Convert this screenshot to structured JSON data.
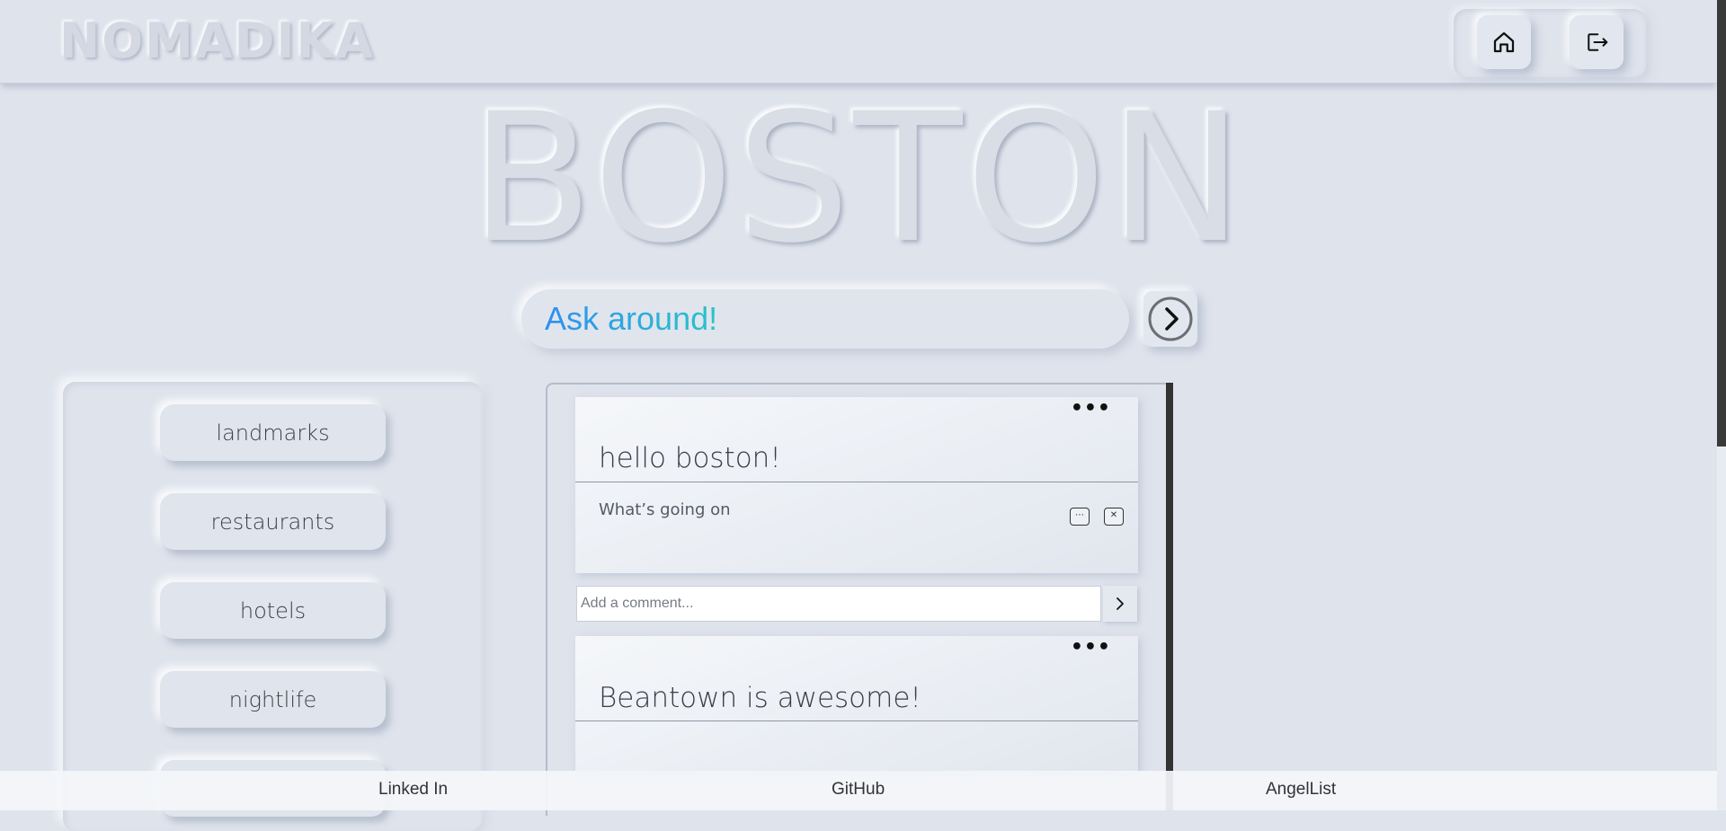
{
  "header": {
    "brand": "NOMADIKA",
    "nav": {
      "home_icon": "home-icon",
      "logout_icon": "logout-icon"
    }
  },
  "city": {
    "title": "BOSTON"
  },
  "ask": {
    "placeholder": "Ask around!",
    "submit_icon": "chevron-right-circle-icon"
  },
  "sidebar": {
    "categories": [
      {
        "label": "landmarks"
      },
      {
        "label": "restaurants"
      },
      {
        "label": "hotels"
      },
      {
        "label": "nightlife"
      }
    ]
  },
  "feed": {
    "posts": [
      {
        "title": "hello boston!",
        "body": "What’s going on",
        "menu_icon": "ellipsis-icon",
        "edit_icon": "edit-icon",
        "delete_icon": "close-icon"
      },
      {
        "title": "Beantown is awesome!",
        "menu_icon": "ellipsis-icon"
      }
    ],
    "comment": {
      "placeholder": "Add a comment...",
      "submit_icon": "chevron-right-icon"
    }
  },
  "footer": {
    "links": [
      {
        "label": "Linked In"
      },
      {
        "label": "GitHub"
      },
      {
        "label": "AngelList"
      }
    ]
  },
  "colors": {
    "background": "#dee3ec",
    "ask_gradient_start": "#2e8ff0",
    "ask_gradient_end": "#2bc4c8",
    "text_dark": "#3a3d44"
  }
}
